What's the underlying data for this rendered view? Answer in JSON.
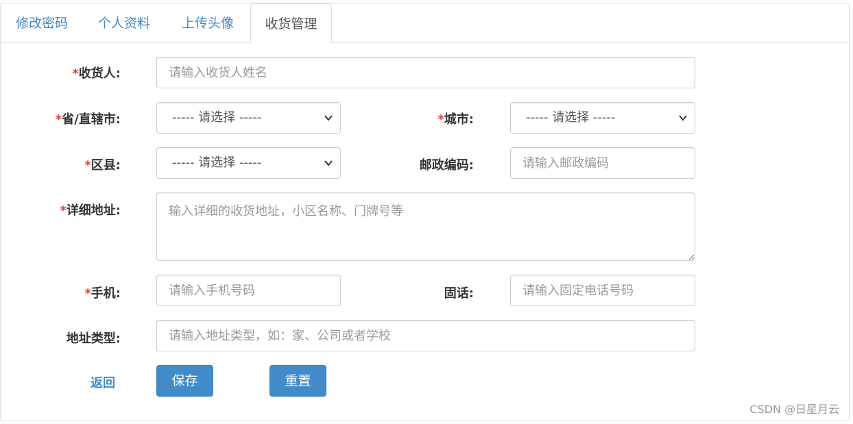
{
  "tabs": [
    {
      "label": "修改密码",
      "active": false
    },
    {
      "label": "个人资料",
      "active": false
    },
    {
      "label": "上传头像",
      "active": false
    },
    {
      "label": "收货管理",
      "active": true
    }
  ],
  "form": {
    "required_mark": "*",
    "receiver": {
      "label": "收货人:",
      "placeholder": "请输入收货人姓名"
    },
    "province": {
      "label": "省/直辖市:",
      "selected": "----- 请选择 -----"
    },
    "city": {
      "label": "城市:",
      "selected": "----- 请选择 -----"
    },
    "district": {
      "label": "区县:",
      "selected": "----- 请选择 -----"
    },
    "zip": {
      "label": "邮政编码:",
      "placeholder": "请输入邮政编码"
    },
    "address": {
      "label": "详细地址:",
      "placeholder": "输入详细的收货地址，小区名称、门牌号等"
    },
    "phone": {
      "label": "手机:",
      "placeholder": "请输入手机号码"
    },
    "tel": {
      "label": "固话:",
      "placeholder": "请输入固定电话号码"
    },
    "addr_type": {
      "label": "地址类型:",
      "placeholder": "请输入地址类型，如：家、公司或者学校"
    }
  },
  "actions": {
    "back": "返回",
    "save": "保存",
    "reset": "重置"
  },
  "watermark": "CSDN @日星月云",
  "colors": {
    "link": "#428bca",
    "primary_button": "#428bca",
    "required": "#e4393c",
    "border": "#cccccc"
  }
}
